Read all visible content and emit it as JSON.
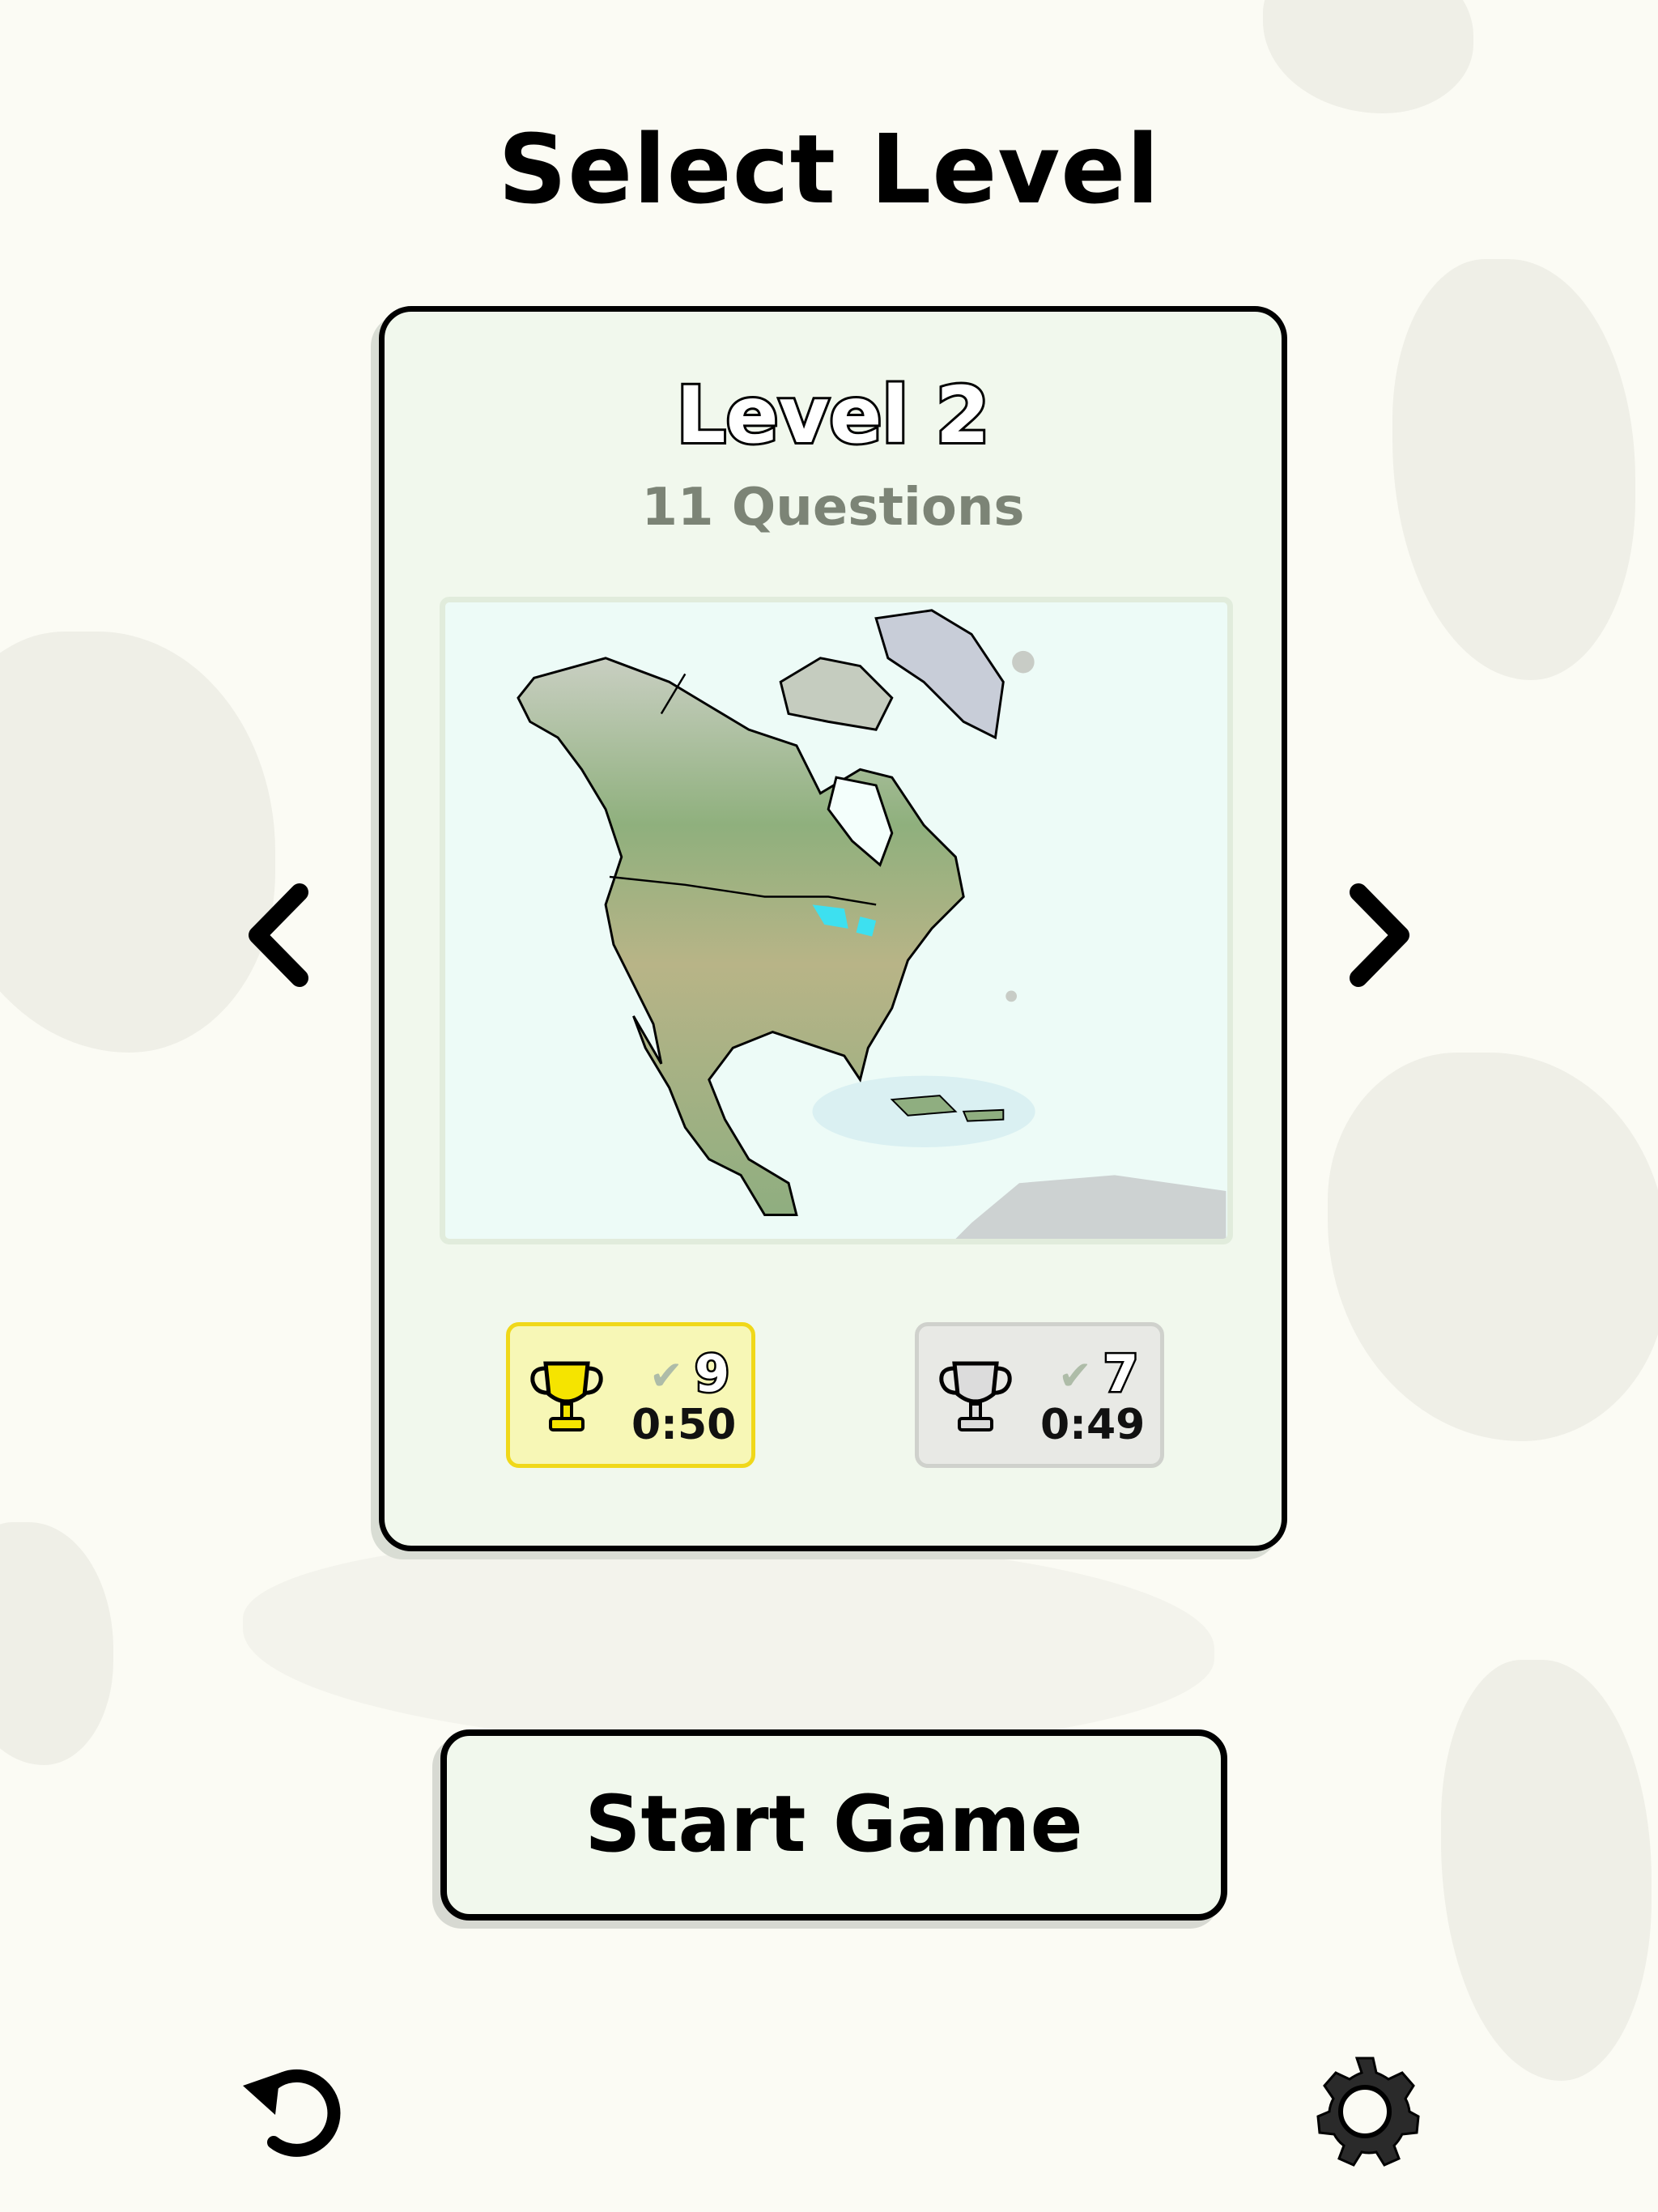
{
  "page": {
    "title": "Select Level"
  },
  "level": {
    "name": "Level 2",
    "questions": "11 Questions",
    "map_region": "North America"
  },
  "stats": [
    {
      "rank": "gold",
      "score": "9",
      "time": "0:50"
    },
    {
      "rank": "silver",
      "score": "7",
      "time": "0:49"
    }
  ],
  "actions": {
    "start_label": "Start Game"
  },
  "icons": {
    "prev": "chevron-left-icon",
    "next": "chevron-right-icon",
    "reset": "undo-icon",
    "settings": "gear-icon",
    "trophy": "trophy-icon",
    "check": "check-icon"
  },
  "colors": {
    "background": "#fbfbf4",
    "card": "#f1f8ed",
    "gold_badge": "#f7f7b6",
    "gold_trophy": "#f5e400",
    "silver_badge": "#e8e9e5",
    "silver_trophy": "#dcdcdc"
  }
}
